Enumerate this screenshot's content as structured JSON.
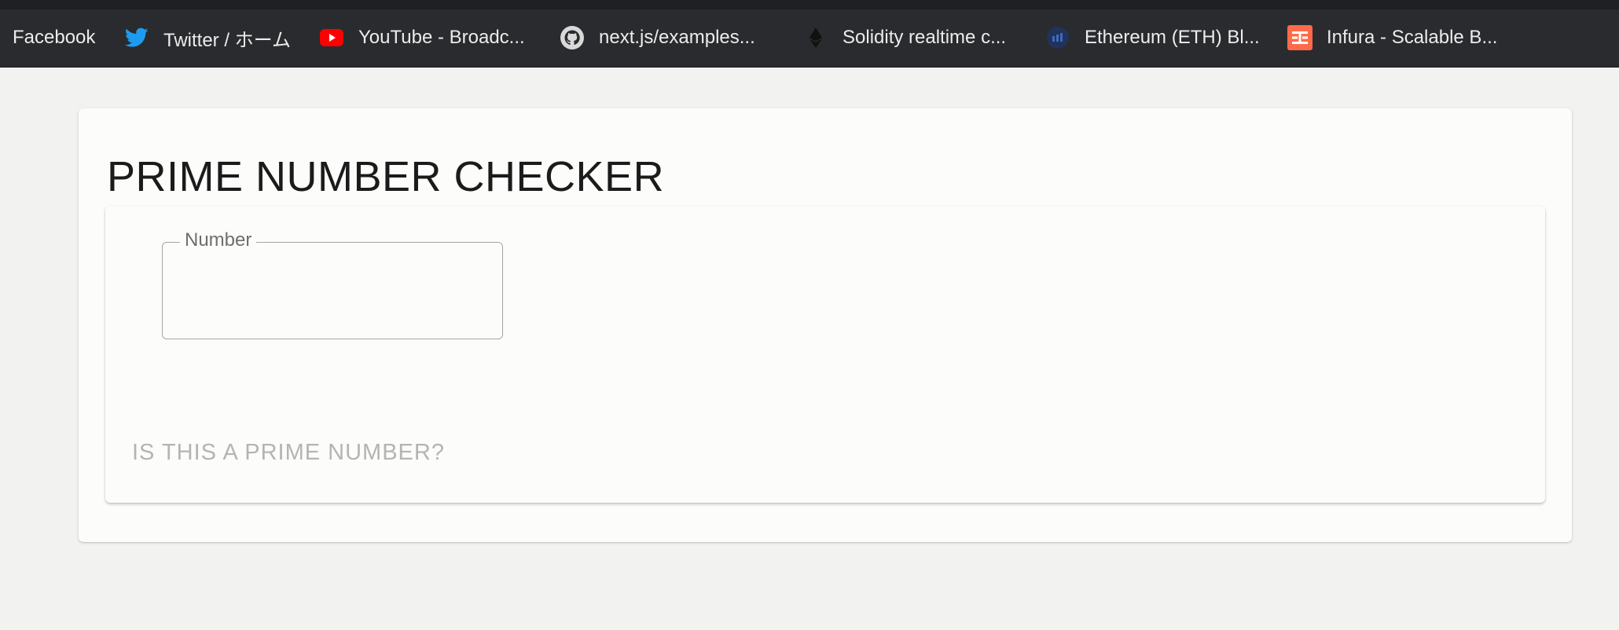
{
  "bookmarks": [
    {
      "label": "Facebook",
      "icon": "none"
    },
    {
      "label": "Twitter / ホーム",
      "icon": "twitter-icon",
      "color": "#1d9bf0"
    },
    {
      "label": "YouTube - Broadc...",
      "icon": "youtube-icon",
      "color": "#ff0000"
    },
    {
      "label": "next.js/examples...",
      "icon": "github-icon"
    },
    {
      "label": "Solidity realtime c...",
      "icon": "ethereum-icon"
    },
    {
      "label": "Ethereum (ETH) Bl...",
      "icon": "etherscan-icon",
      "color": "#21325b"
    },
    {
      "label": "Infura - Scalable B...",
      "icon": "infura-icon",
      "color": "#ff6b4a"
    }
  ],
  "page": {
    "title": "PRIME NUMBER CHECKER"
  },
  "form": {
    "number_label": "Number",
    "number_value": "",
    "submit_label": "IS THIS A PRIME NUMBER?"
  }
}
